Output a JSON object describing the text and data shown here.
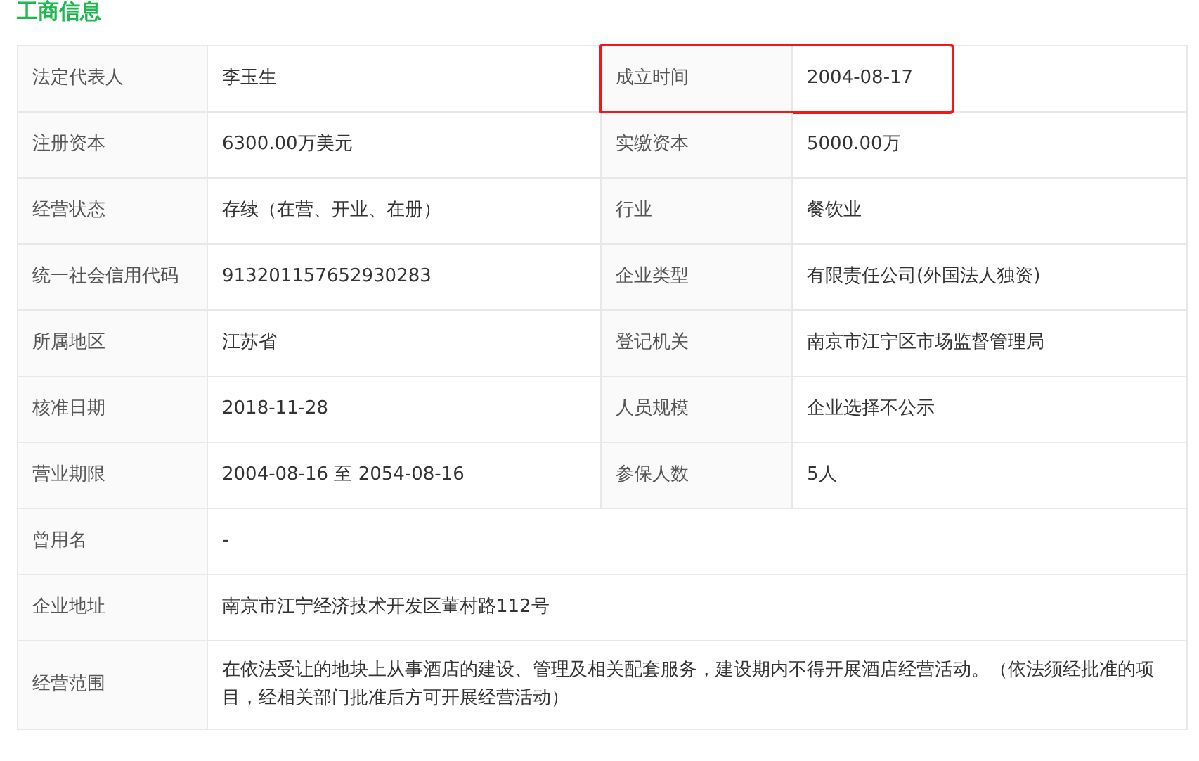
{
  "title": "工商信息",
  "rows": [
    {
      "pairs": [
        {
          "label": "法定代表人",
          "value": "李玉生",
          "highlighted": false
        },
        {
          "label": "成立时间",
          "value": "2004-08-17",
          "highlighted": true
        }
      ]
    },
    {
      "pairs": [
        {
          "label": "注册资本",
          "value": "6300.00万美元",
          "highlighted": false
        },
        {
          "label": "实缴资本",
          "value": "5000.00万",
          "highlighted": false
        }
      ]
    },
    {
      "pairs": [
        {
          "label": "经营状态",
          "value": "存续（在营、开业、在册）",
          "highlighted": false
        },
        {
          "label": "行业",
          "value": "餐饮业",
          "highlighted": false
        }
      ]
    },
    {
      "pairs": [
        {
          "label": "统一社会信用代码",
          "value": "913201157652930283",
          "highlighted": false
        },
        {
          "label": "企业类型",
          "value": "有限责任公司(外国法人独资)",
          "highlighted": false
        }
      ]
    },
    {
      "pairs": [
        {
          "label": "所属地区",
          "value": "江苏省",
          "highlighted": false
        },
        {
          "label": "登记机关",
          "value": "南京市江宁区市场监督管理局",
          "highlighted": false
        }
      ]
    },
    {
      "pairs": [
        {
          "label": "核准日期",
          "value": "2018-11-28",
          "highlighted": false
        },
        {
          "label": "人员规模",
          "value": "企业选择不公示",
          "highlighted": false
        }
      ]
    },
    {
      "pairs": [
        {
          "label": "营业期限",
          "value": "2004-08-16 至 2054-08-16",
          "highlighted": false
        },
        {
          "label": "参保人数",
          "value": "5人",
          "highlighted": false
        }
      ]
    },
    {
      "pairs": [
        {
          "label": "曾用名",
          "value": "-",
          "highlighted": false
        }
      ]
    },
    {
      "pairs": [
        {
          "label": "企业地址",
          "value": "南京市江宁经济技术开发区董村路112号",
          "highlighted": false
        }
      ]
    },
    {
      "pairs": [
        {
          "label": "经营范围",
          "value": "在依法受让的地块上从事酒店的建设、管理及相关配套服务，建设期内不得开展酒店经营活动。（依法须经批准的项目，经相关部门批准后方可开展经营活动）",
          "highlighted": false
        }
      ]
    }
  ]
}
